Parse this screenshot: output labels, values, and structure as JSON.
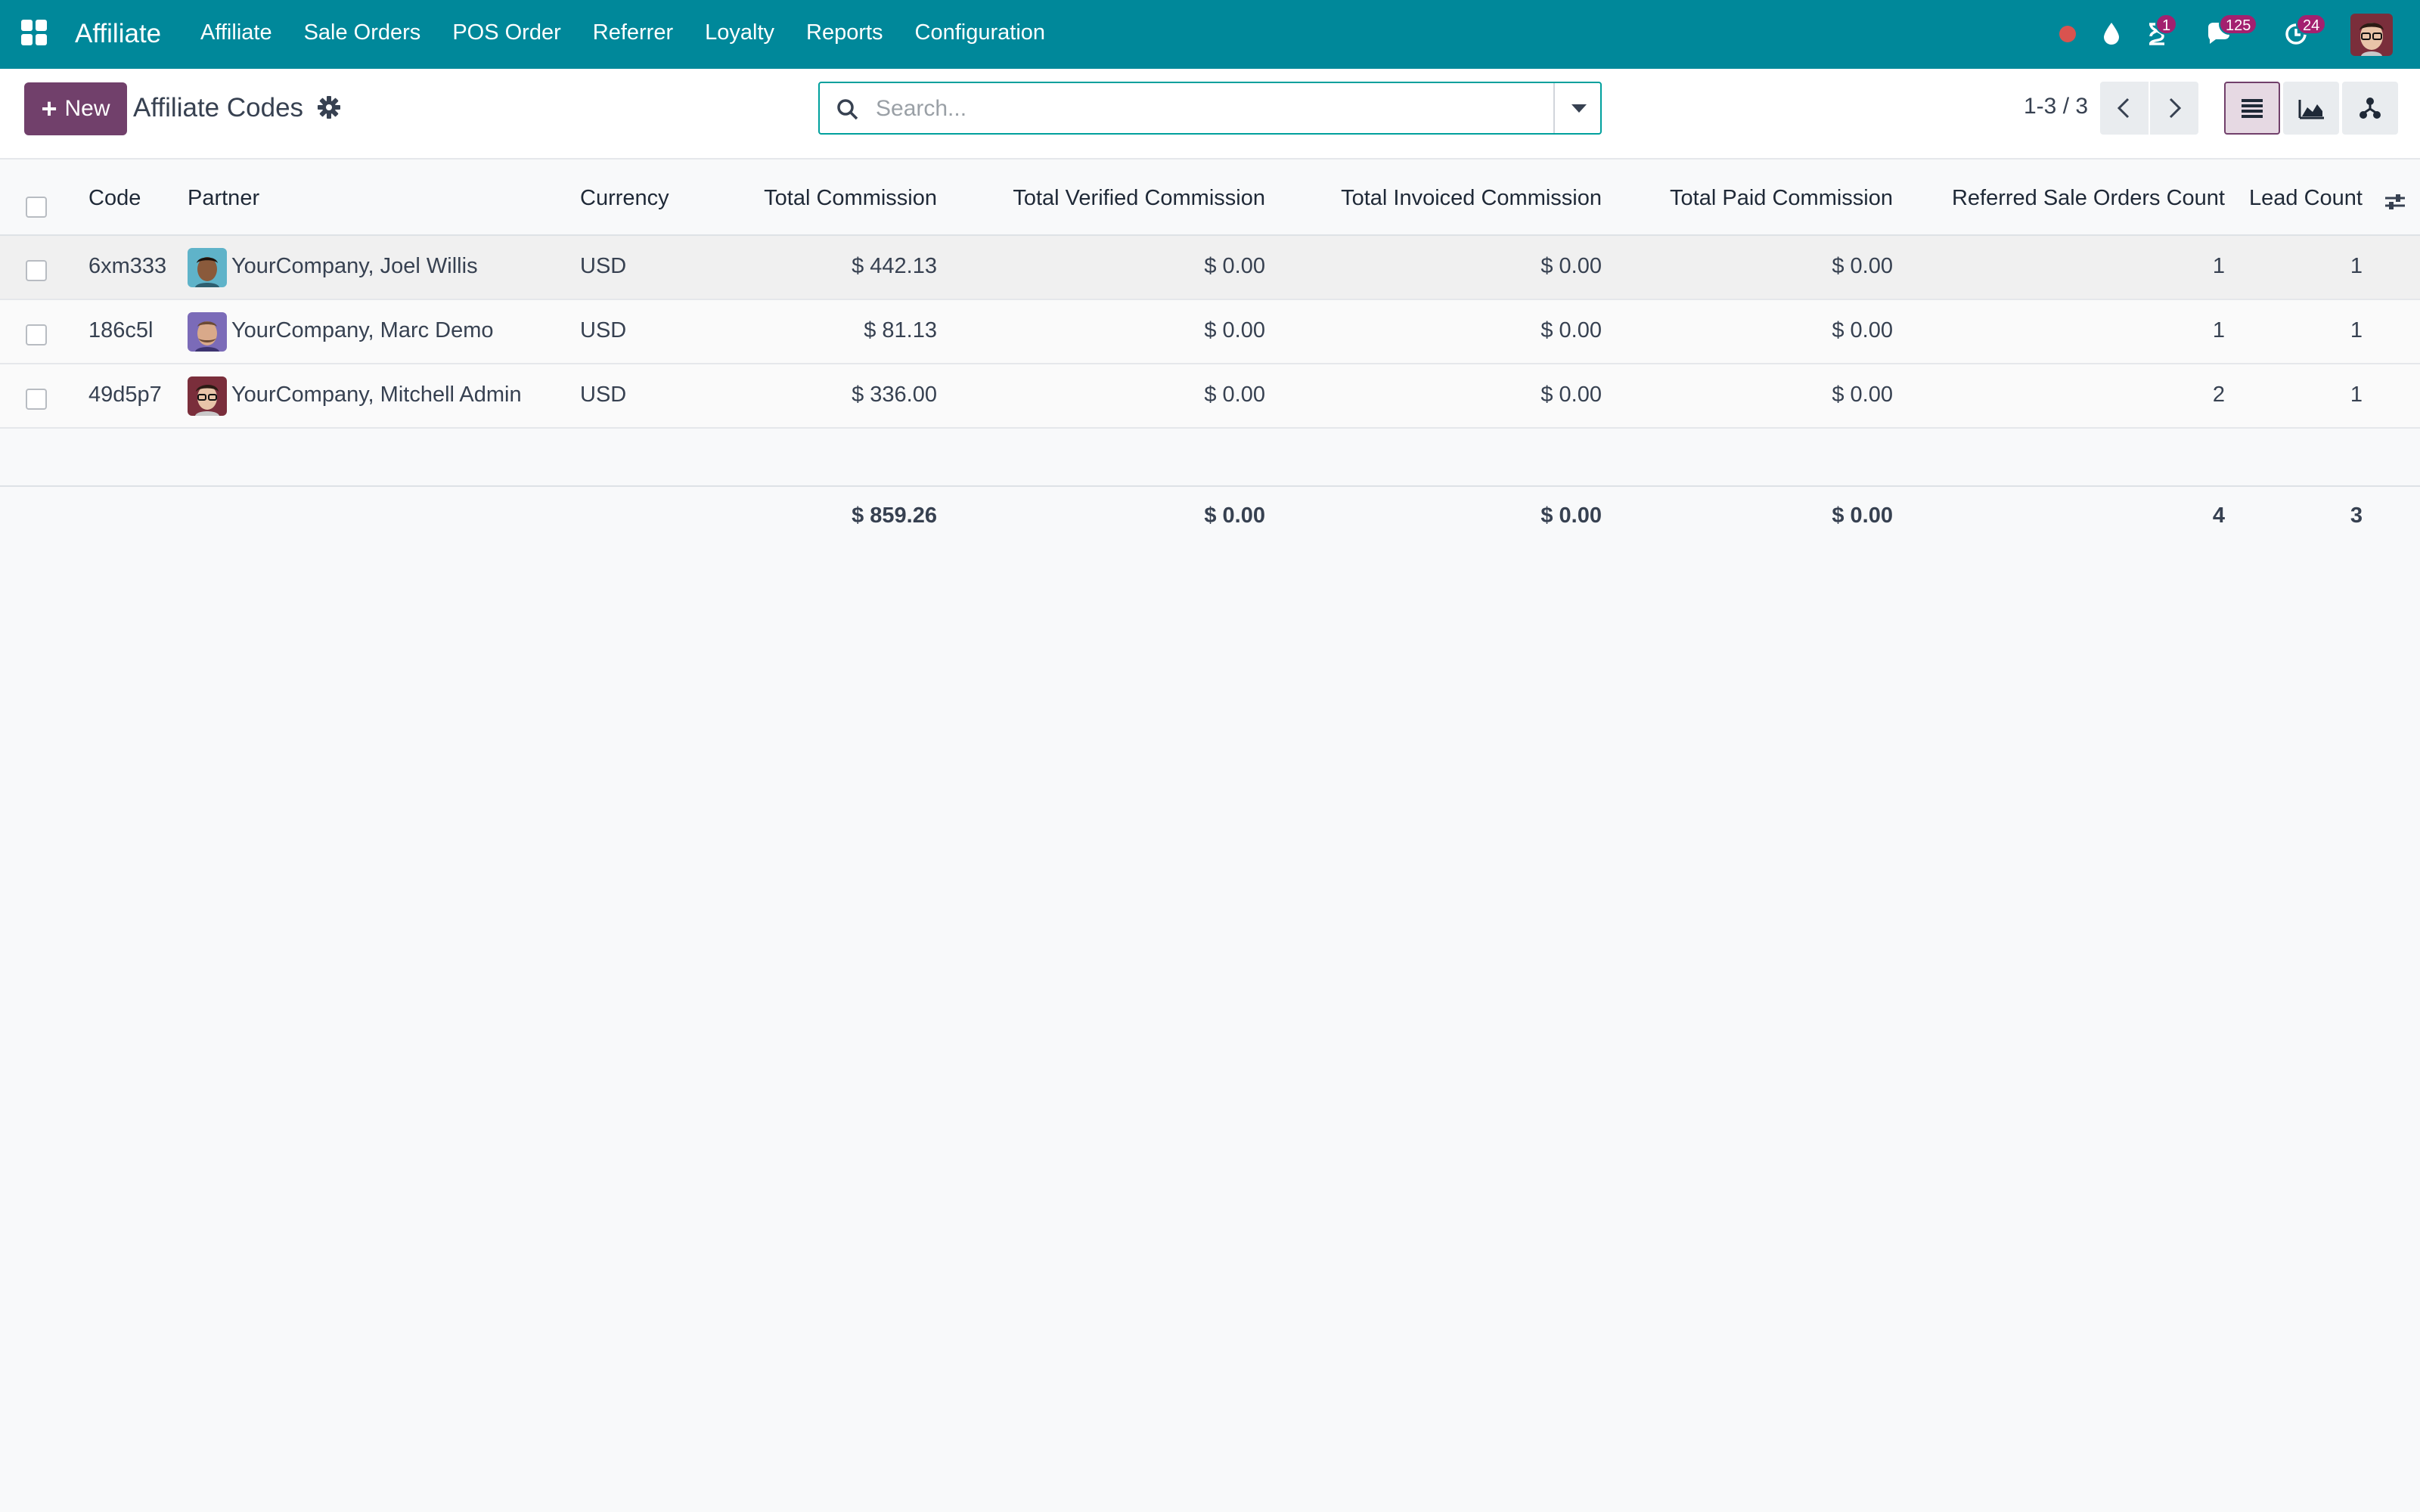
{
  "navbar": {
    "brand": "Affiliate",
    "menu": [
      "Affiliate",
      "Sale Orders",
      "POS Order",
      "Referrer",
      "Loyalty",
      "Reports",
      "Configuration"
    ],
    "badges": {
      "activities": "1",
      "messages": "125",
      "updates": "24"
    },
    "color": "#00889a"
  },
  "control_panel": {
    "new_label": "New",
    "title": "Affiliate Codes",
    "search_placeholder": "Search...",
    "pager": "1-3 / 3",
    "accent": "#71406b"
  },
  "table": {
    "columns": {
      "code": "Code",
      "partner": "Partner",
      "currency": "Currency",
      "total_commission": "Total Commission",
      "verified": "Total Verified Commission",
      "invoiced": "Total Invoiced Commission",
      "paid": "Total Paid Commission",
      "orders": "Referred Sale Orders Count",
      "leads": "Lead Count"
    },
    "rows": [
      {
        "code": "6xm333",
        "partner": "YourCompany, Joel Willis",
        "currency": "USD",
        "total_commission": "$ 442.13",
        "verified": "$ 0.00",
        "invoiced": "$ 0.00",
        "paid": "$ 0.00",
        "orders": "1",
        "leads": "1"
      },
      {
        "code": "186c5l",
        "partner": "YourCompany, Marc Demo",
        "currency": "USD",
        "total_commission": "$ 81.13",
        "verified": "$ 0.00",
        "invoiced": "$ 0.00",
        "paid": "$ 0.00",
        "orders": "1",
        "leads": "1"
      },
      {
        "code": "49d5p7",
        "partner": "YourCompany, Mitchell Admin",
        "currency": "USD",
        "total_commission": "$ 336.00",
        "verified": "$ 0.00",
        "invoiced": "$ 0.00",
        "paid": "$ 0.00",
        "orders": "2",
        "leads": "1"
      }
    ],
    "totals": {
      "total_commission": "$ 859.26",
      "verified": "$ 0.00",
      "invoiced": "$ 0.00",
      "paid": "$ 0.00",
      "orders": "4",
      "leads": "3"
    }
  }
}
